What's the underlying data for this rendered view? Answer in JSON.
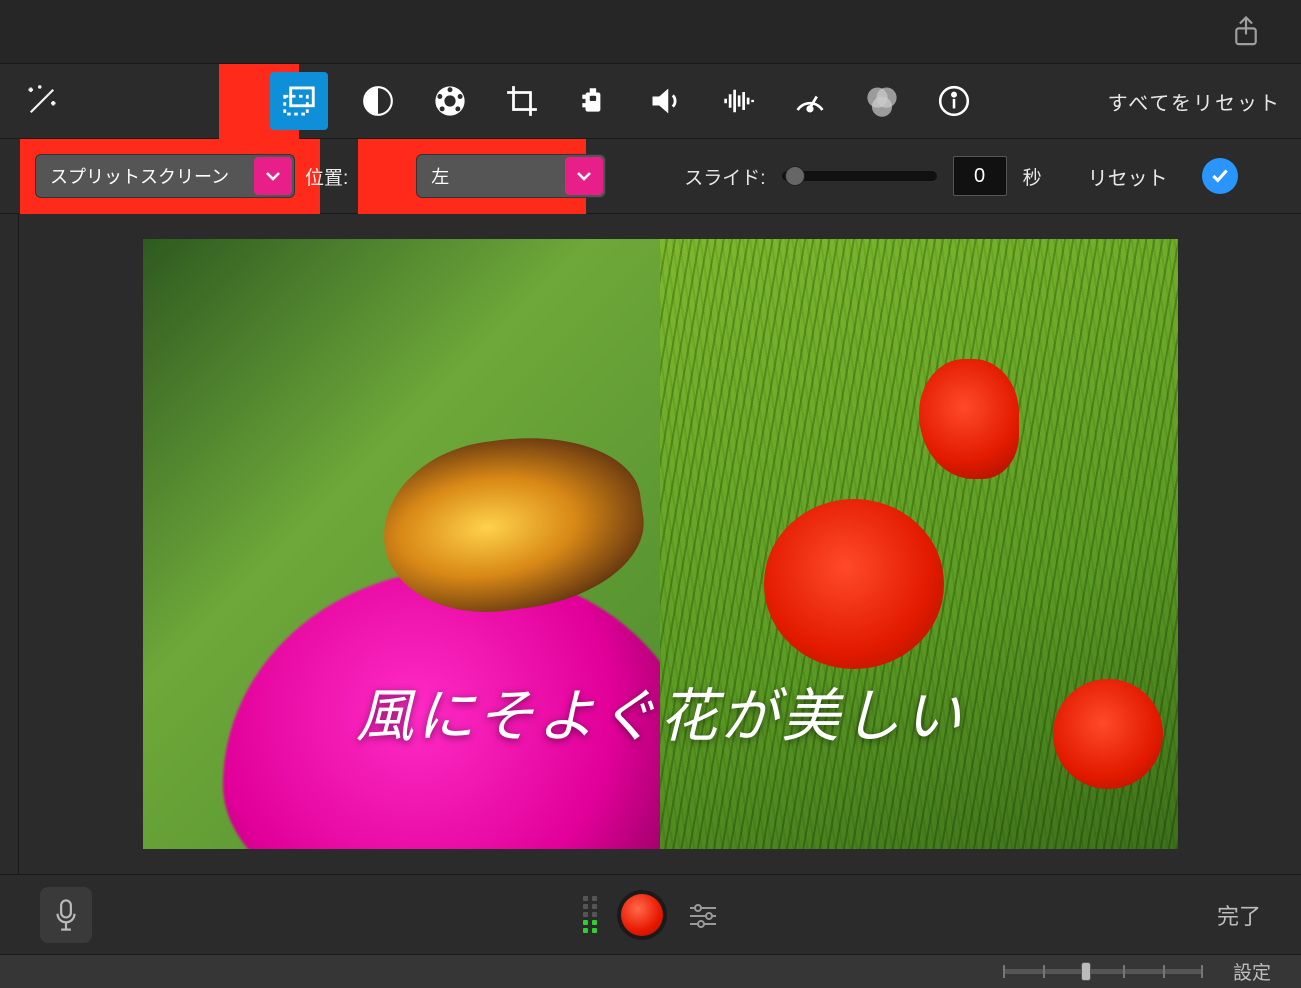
{
  "toolbar": {
    "reset_all": "すべてをリセット"
  },
  "subbar": {
    "mode": "スプリットスクリーン",
    "position_label": "位置:",
    "position_value": "左",
    "slide_label": "スライド:",
    "slide_value": "0",
    "seconds": "秒",
    "reset": "リセット"
  },
  "preview": {
    "title_overlay": "風にそよぐ花が美しい"
  },
  "controlbar": {
    "done": "完了"
  },
  "footer": {
    "settings": "設定"
  }
}
